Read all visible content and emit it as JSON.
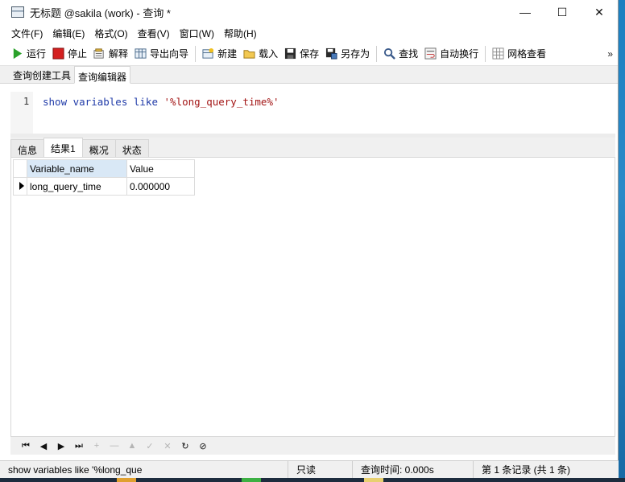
{
  "window": {
    "title": "无标题 @sakila (work) - 查询 *",
    "controls": [
      "—",
      "☐",
      "✕"
    ]
  },
  "menu": [
    "文件(F)",
    "编辑(E)",
    "格式(O)",
    "查看(V)",
    "窗口(W)",
    "帮助(H)"
  ],
  "toolbar": {
    "run": "运行",
    "stop": "停止",
    "explain": "解释",
    "export_wizard": "导出向导",
    "new": "新建",
    "load": "载入",
    "save": "保存",
    "save_as": "另存为",
    "find": "查找",
    "word_wrap": "自动换行",
    "grid_view": "网格查看",
    "more": "»"
  },
  "subtabs": [
    "查询创建工具",
    "查询编辑器"
  ],
  "editor": {
    "line_number": "1",
    "keywords": "show variables like ",
    "string": "'%long_query_time%'"
  },
  "result_tabs": [
    "信息",
    "结果1",
    "概况",
    "状态"
  ],
  "grid": {
    "columns": [
      "Variable_name",
      "Value"
    ],
    "rows": [
      [
        "long_query_time",
        "0.000000"
      ]
    ]
  },
  "nav": [
    "⏮",
    "◀",
    "▶",
    "⏭",
    "+",
    "—",
    "▲",
    "✓",
    "✕",
    "↻",
    "⊘"
  ],
  "status": {
    "sql": "show variables like '%long_que",
    "mode": "只读",
    "query_time": "查询时间: 0.000s",
    "records": "第 1 条记录 (共 1 条)"
  },
  "colors": {
    "run_icon": "#2aa12a",
    "stop_icon": "#d42020",
    "selected_header": "#d9e8f6",
    "keyword": "#1f3aa8",
    "string": "#a31515"
  }
}
